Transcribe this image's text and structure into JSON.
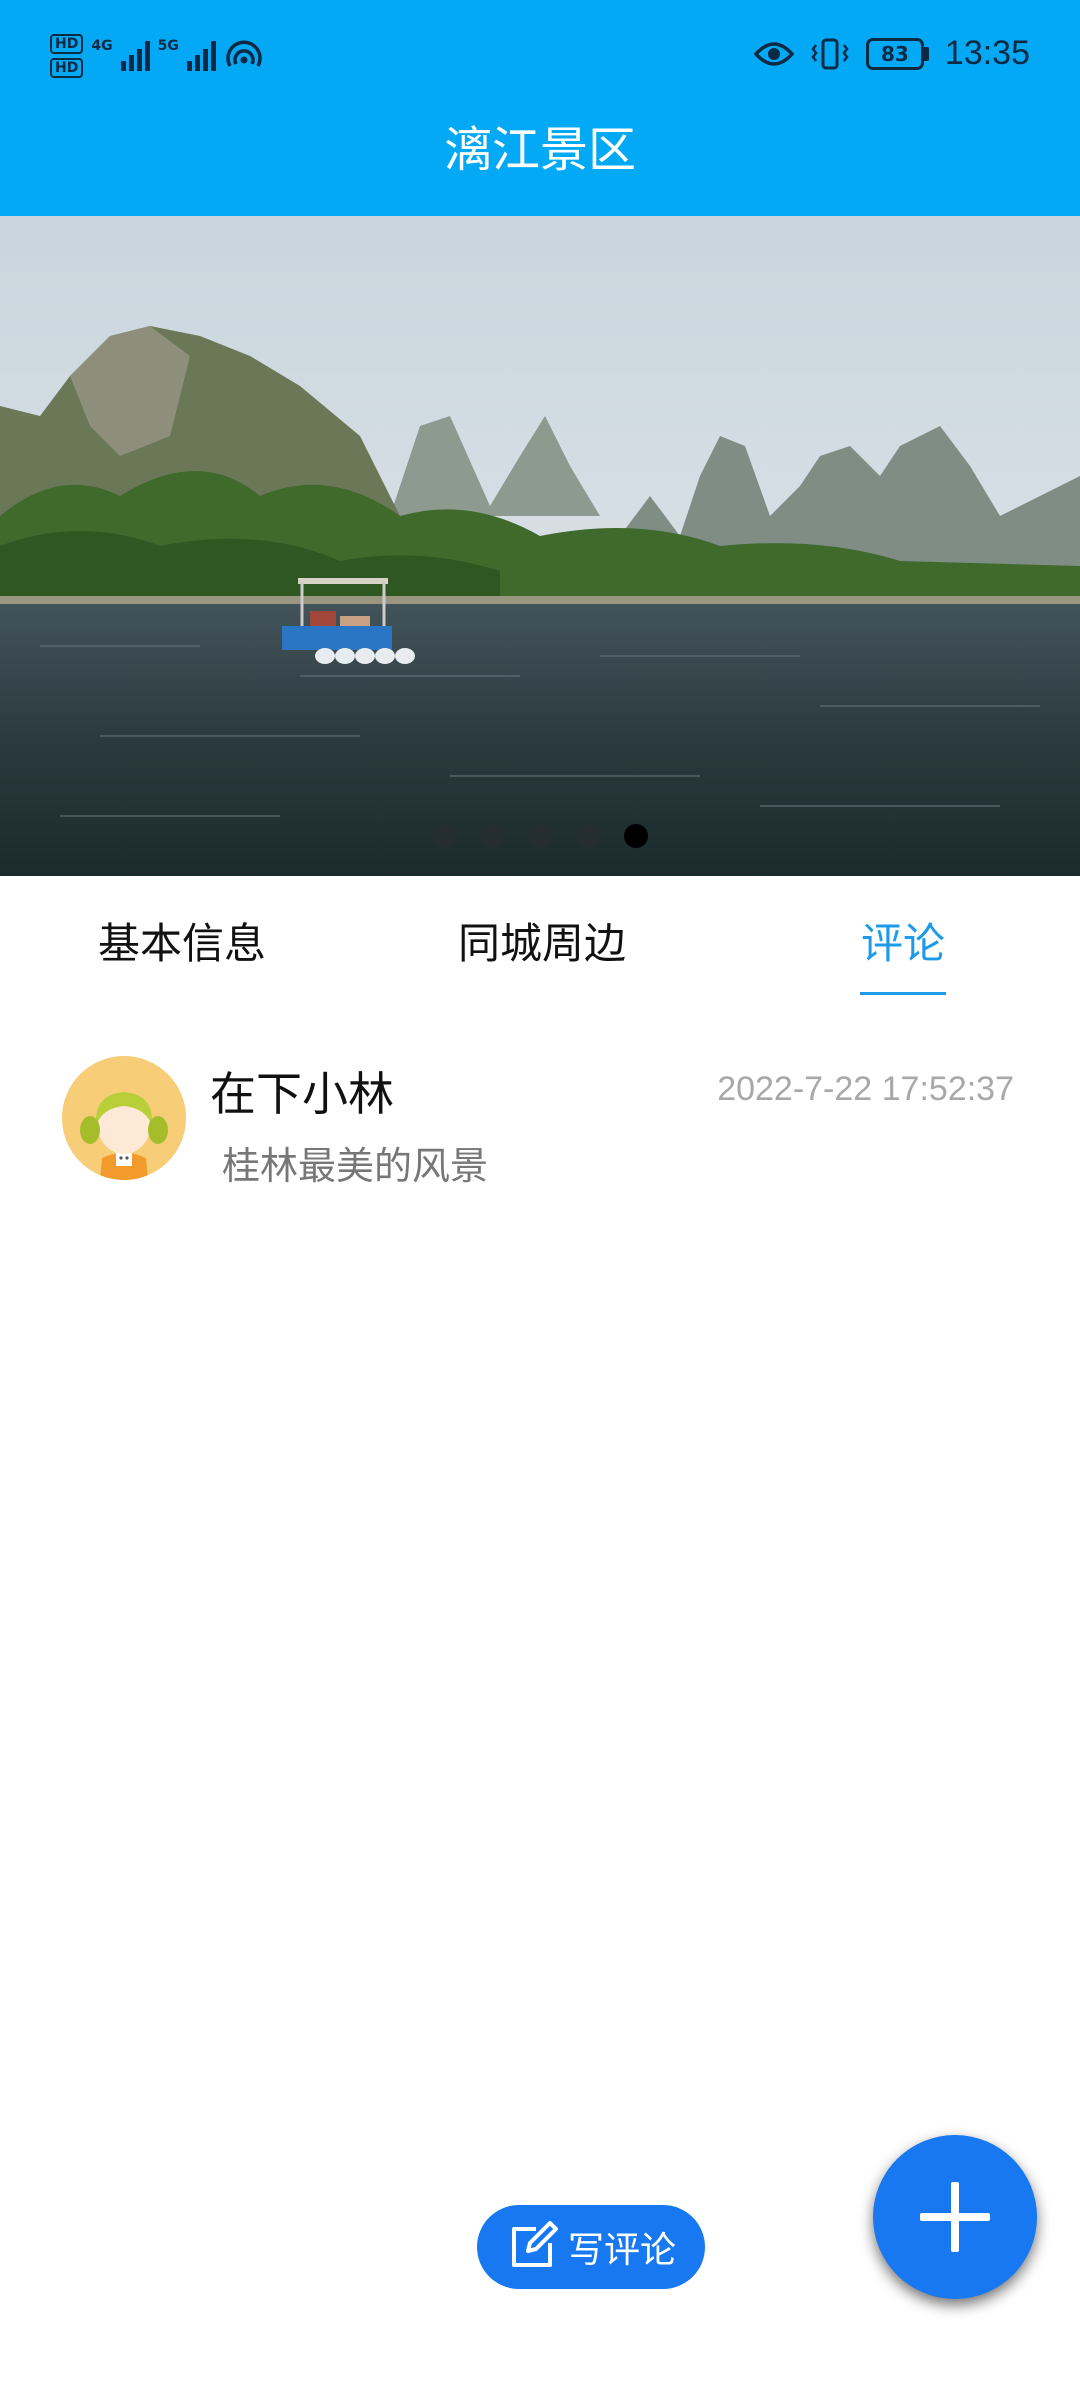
{
  "status_bar": {
    "hd_labels": [
      "HD",
      "HD"
    ],
    "network_1": "4G",
    "network_2": "5G",
    "battery": "83",
    "time": "13:35",
    "icons": [
      "signal-icon",
      "hotspot-icon",
      "eye-icon",
      "vibrate-icon",
      "battery-icon"
    ]
  },
  "header": {
    "title": "漓江景区"
  },
  "banner": {
    "image": "li-river-karst-landscape",
    "slide_count": 5,
    "active_slide": 5
  },
  "tabs": [
    {
      "label": "基本信息",
      "active": false
    },
    {
      "label": "同城周边",
      "active": false
    },
    {
      "label": "评论",
      "active": true
    }
  ],
  "comments": [
    {
      "avatar": "girl-avatar",
      "username": "在下小林",
      "time": "2022-7-22 17:52:37",
      "text": "桂林最美的风景"
    }
  ],
  "actions": {
    "write_comment_label": "写评论",
    "fab_icon": "plus-icon"
  },
  "colors": {
    "header_bg": "#03a9f4",
    "tab_active": "#1e9be8",
    "button_blue": "#1778f2"
  }
}
